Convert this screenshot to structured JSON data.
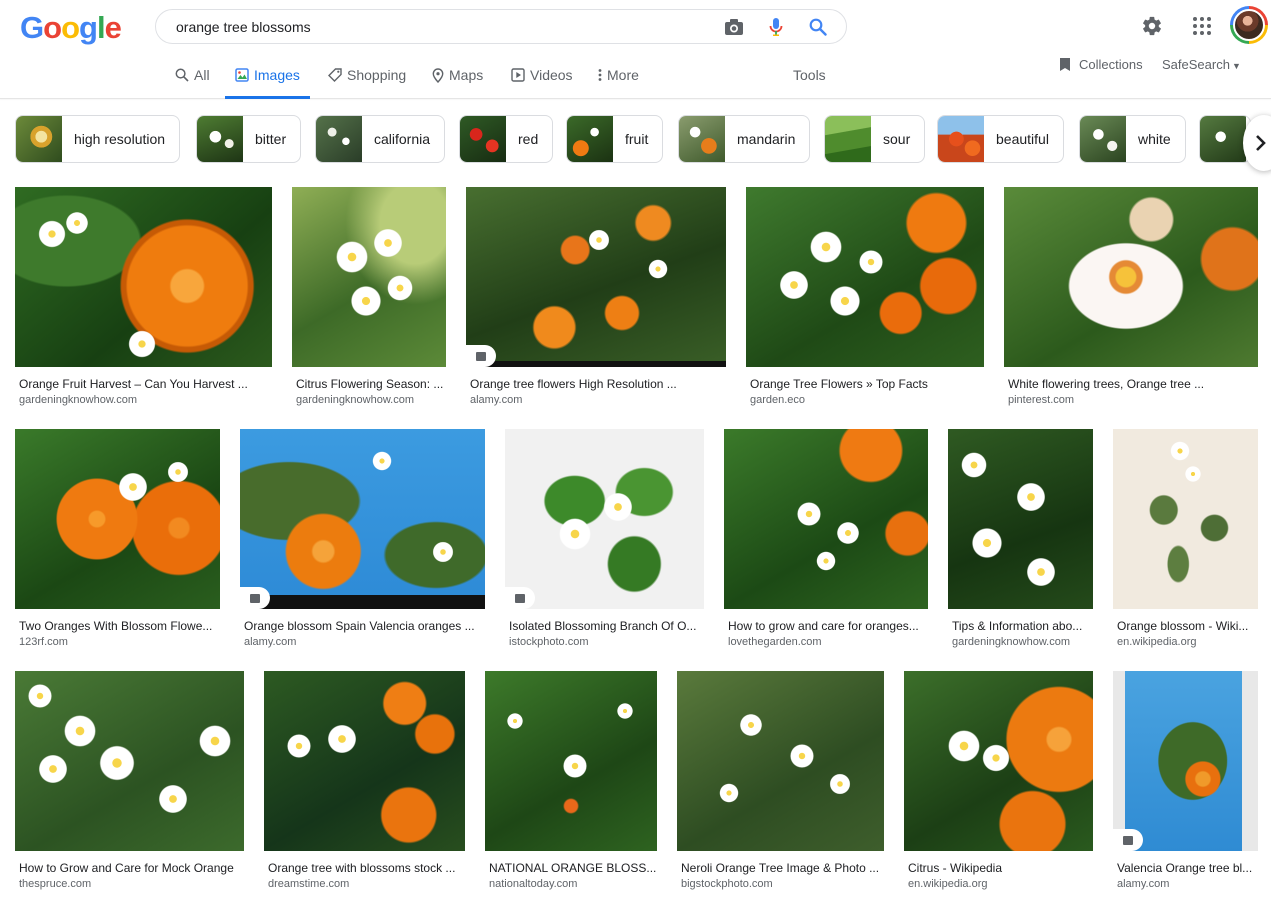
{
  "search": {
    "query": "orange tree blossoms"
  },
  "logo": [
    "G",
    "o",
    "o",
    "g",
    "l",
    "e"
  ],
  "nav": {
    "tabs": [
      "All",
      "Images",
      "Shopping",
      "Maps",
      "Videos",
      "More"
    ],
    "tools": "Tools",
    "collections": "Collections",
    "safesearch": "SafeSearch"
  },
  "chips": [
    "high resolution",
    "bitter",
    "california",
    "red",
    "fruit",
    "mandarin",
    "sour",
    "beautiful",
    "white"
  ],
  "results": [
    {
      "title": "Orange Fruit Harvest – Can You Harvest ...",
      "source": "gardeningknowhow.com"
    },
    {
      "title": "Citrus Flowering Season: ...",
      "source": "gardeningknowhow.com"
    },
    {
      "title": "Orange tree flowers High Resolution ...",
      "source": "alamy.com"
    },
    {
      "title": "Orange Tree Flowers » Top Facts",
      "source": "garden.eco"
    },
    {
      "title": "White flowering trees, Orange tree ...",
      "source": "pinterest.com"
    },
    {
      "title": "Two Oranges With Blossom Flowe...",
      "source": "123rf.com"
    },
    {
      "title": "Orange blossom Spain Valencia oranges ...",
      "source": "alamy.com"
    },
    {
      "title": "Isolated Blossoming Branch Of O...",
      "source": "istockphoto.com"
    },
    {
      "title": "How to grow and care for oranges...",
      "source": "lovethegarden.com"
    },
    {
      "title": "Tips & Information abo...",
      "source": "gardeningknowhow.com"
    },
    {
      "title": "Orange blossom - Wiki...",
      "source": "en.wikipedia.org"
    },
    {
      "title": "How to Grow and Care for Mock Orange",
      "source": "thespruce.com"
    },
    {
      "title": "Orange tree with blossoms stock ...",
      "source": "dreamstime.com"
    },
    {
      "title": "NATIONAL ORANGE BLOSS...",
      "source": "nationaltoday.com"
    },
    {
      "title": "Neroli Orange Tree Image & Photo ...",
      "source": "bigstockphoto.com"
    },
    {
      "title": "Citrus - Wikipedia",
      "source": "en.wikipedia.org"
    },
    {
      "title": "Valencia Orange tree bl...",
      "source": "alamy.com"
    }
  ],
  "colors": {
    "accent": "#1a73e8",
    "logo": [
      "#4285f4",
      "#ea4335",
      "#fbbc05",
      "#4285f4",
      "#34a853",
      "#ea4335"
    ]
  }
}
